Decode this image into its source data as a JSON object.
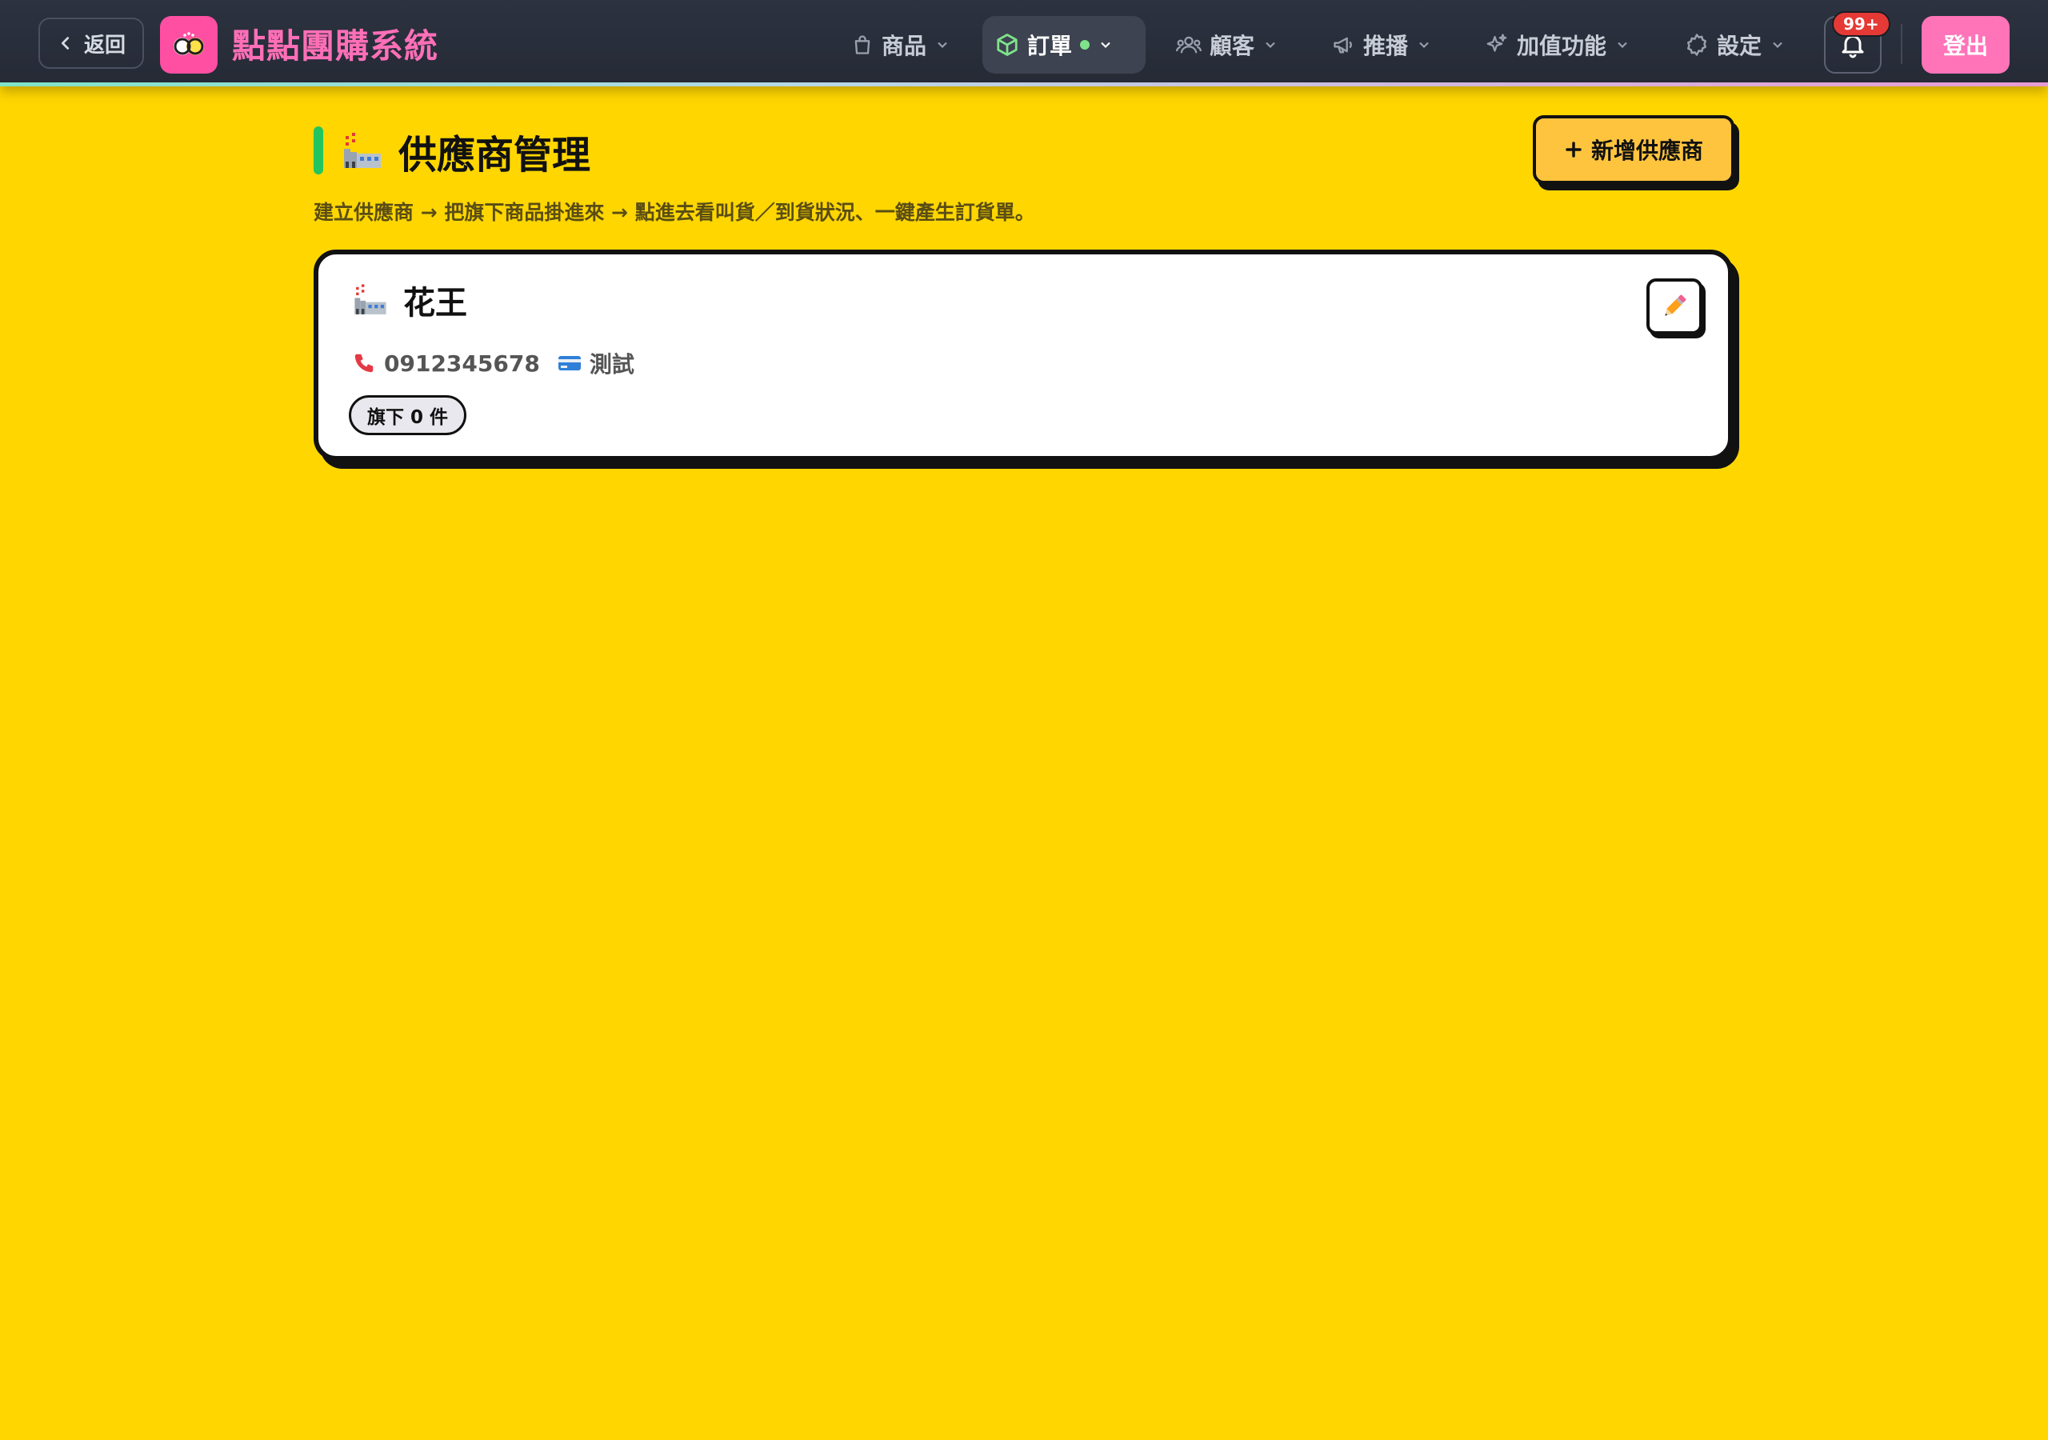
{
  "nav": {
    "back_label": "返回",
    "brand": "點點團購系統",
    "items": [
      {
        "label": "商品",
        "icon": "bag-icon"
      },
      {
        "label": "訂單",
        "icon": "box-icon"
      },
      {
        "label": "顧客",
        "icon": "users-icon"
      },
      {
        "label": "推播",
        "icon": "megaphone-icon"
      },
      {
        "label": "加值功能",
        "icon": "sparkles-icon"
      },
      {
        "label": "設定",
        "icon": "gear-icon"
      }
    ],
    "active_item": "訂單",
    "notification_badge": "99+",
    "logout_label": "登出"
  },
  "page": {
    "title": "供應商管理",
    "subtitle": "建立供應商 → 把旗下商品掛進來 → 點進去看叫貨／到貨狀況、一鍵產生訂貨單。",
    "add_button": "新增供應商"
  },
  "suppliers": [
    {
      "name": "花王",
      "phone": "0912345678",
      "note": "測試",
      "product_count_label": "旗下 0 件"
    }
  ],
  "colors": {
    "page_bg": "#FFD600",
    "nav_bg": "#252a35",
    "brand": "#ff6fb8",
    "accent_green": "#22c55e",
    "add_button": "#FFC43D",
    "logout": "#ff73b9",
    "badge": "#e53935"
  }
}
